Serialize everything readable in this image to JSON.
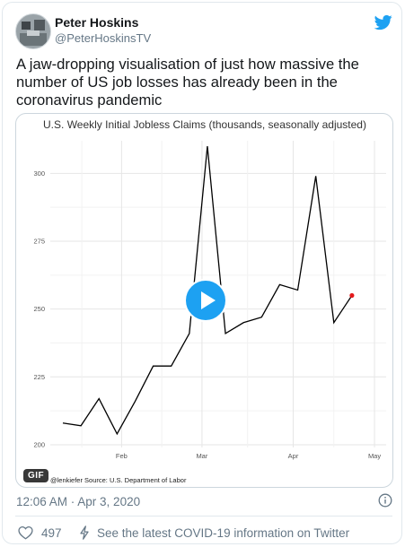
{
  "tweet": {
    "display_name": "Peter Hoskins",
    "handle": "@PeterHoskinsTV",
    "text": "A jaw-dropping visualisation of just how massive the number of US job losses has already been in the coronavirus pandemic",
    "timestamp": "12:06 AM · Apr 3, 2020",
    "likes": "497",
    "covid_link": "See the latest COVID-19 information on Twitter",
    "media_badge": "GIF"
  },
  "icons": {
    "brand": "twitter-bird-icon",
    "play": "play-icon",
    "info": "info-icon",
    "like": "heart-icon",
    "covid": "lightning-icon"
  },
  "colors": {
    "accent": "#1da1f2",
    "text_primary": "#14171a",
    "text_secondary": "#657786",
    "line": "#000000",
    "highlight_point": "#e41a1c"
  },
  "chart_data": {
    "type": "line",
    "title": "U.S. Weekly Initial Jobless Claims (thousands, seasonally adjusted)",
    "source": "@lenkiefer Source: U.S. Department of Labor",
    "xlabel": "",
    "ylabel": "",
    "x_ticks": [
      "Feb",
      "Mar",
      "Apr",
      "May"
    ],
    "y_ticks": [
      200,
      225,
      250,
      275,
      300
    ],
    "ylim": [
      199,
      312
    ],
    "grid": true,
    "x": [
      "Jan 11",
      "Jan 18",
      "Jan 25",
      "Feb 1",
      "Feb 8",
      "Feb 15",
      "Feb 22",
      "Feb 29",
      "Mar 7",
      "Mar 14",
      "Mar 21",
      "Mar 28",
      "Apr 4",
      "Apr 11",
      "Apr 18",
      "Apr 25",
      "May 2",
      "May 9"
    ],
    "values": [
      208,
      207,
      217,
      204,
      216,
      229,
      229,
      241,
      310,
      241,
      245,
      247,
      259,
      257,
      299,
      245,
      255,
      255
    ],
    "highlight_last": true
  }
}
